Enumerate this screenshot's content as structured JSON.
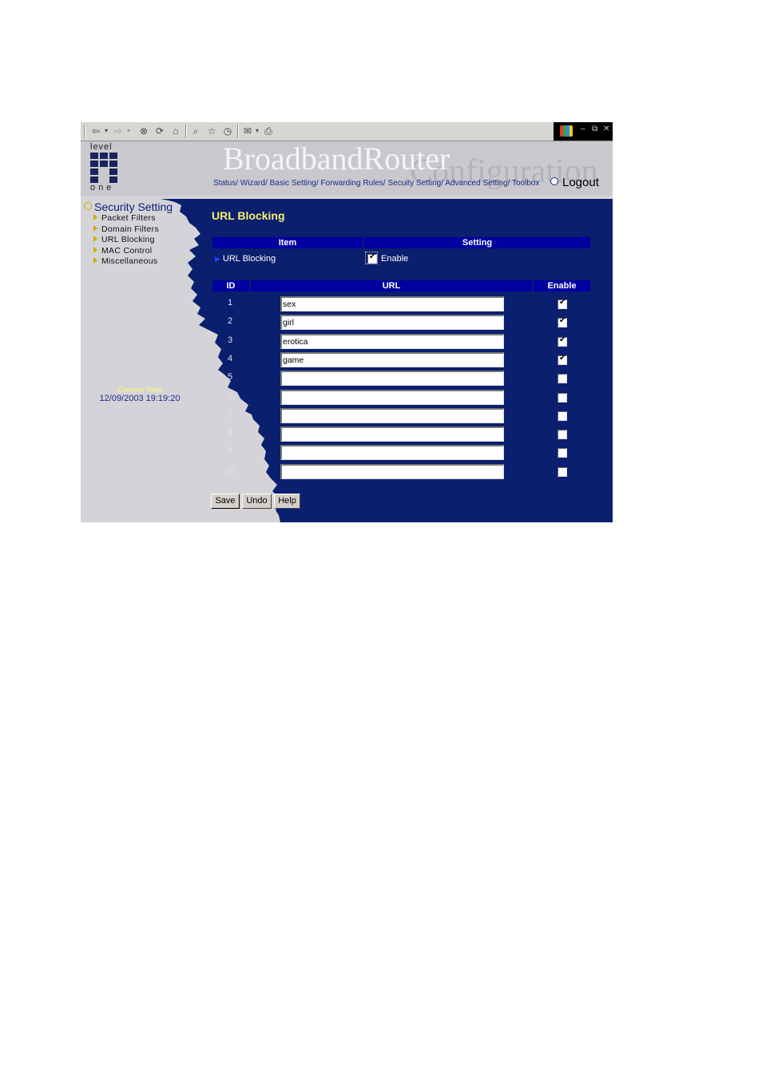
{
  "browser": {
    "toolbar_icons": [
      "back-icon",
      "forward-icon",
      "stop-icon",
      "refresh-icon",
      "home-icon",
      "search-icon",
      "favorites-icon",
      "history-icon",
      "mail-icon",
      "print-icon"
    ],
    "window_controls": [
      "minimize",
      "restore",
      "close"
    ]
  },
  "header": {
    "logo_top": "level",
    "logo_bottom": "one",
    "brand": "BroadbandRouter",
    "brand_sub": "Configuration",
    "nav": [
      "Status/",
      "Wizard/",
      "Basic Setting/",
      "Forwarding Rules/",
      "Secuity Setting/",
      "Advanced Setting/",
      "Toolbox"
    ],
    "logout": "Logout"
  },
  "sidebar": {
    "title": "Security Setting",
    "items": [
      "Packet Filters",
      "Domain Filters",
      "URL Blocking",
      "MAC Control",
      "Miscellaneous"
    ]
  },
  "time": {
    "label": "Current Time",
    "value": "12/09/2003 19:19:20"
  },
  "main": {
    "title": "URL Blocking",
    "settings_table": {
      "headers": [
        "Item",
        "Setting"
      ],
      "row": {
        "item": "URL Blocking",
        "setting_label": "Enable",
        "enabled": true
      }
    },
    "url_table": {
      "headers": [
        "ID",
        "URL",
        "Enable"
      ],
      "rows": [
        {
          "id": "1",
          "url": "sex",
          "enabled": true
        },
        {
          "id": "2",
          "url": "girl",
          "enabled": true
        },
        {
          "id": "3",
          "url": "erotica",
          "enabled": true
        },
        {
          "id": "4",
          "url": "game",
          "enabled": true
        },
        {
          "id": "5",
          "url": "",
          "enabled": false
        },
        {
          "id": "6",
          "url": "",
          "enabled": false
        },
        {
          "id": "7",
          "url": "",
          "enabled": false
        },
        {
          "id": "8",
          "url": "",
          "enabled": false
        },
        {
          "id": "9",
          "url": "",
          "enabled": false
        },
        {
          "id": "10",
          "url": "",
          "enabled": false
        }
      ]
    },
    "buttons": {
      "save": "Save",
      "undo": "Undo",
      "help": "Help"
    }
  },
  "colors": {
    "panel_blue": "#0a1f6e",
    "header_bar": "#0000a0",
    "title_yellow": "#f8f06c",
    "sidebar_bg": "#d4d4d8"
  }
}
